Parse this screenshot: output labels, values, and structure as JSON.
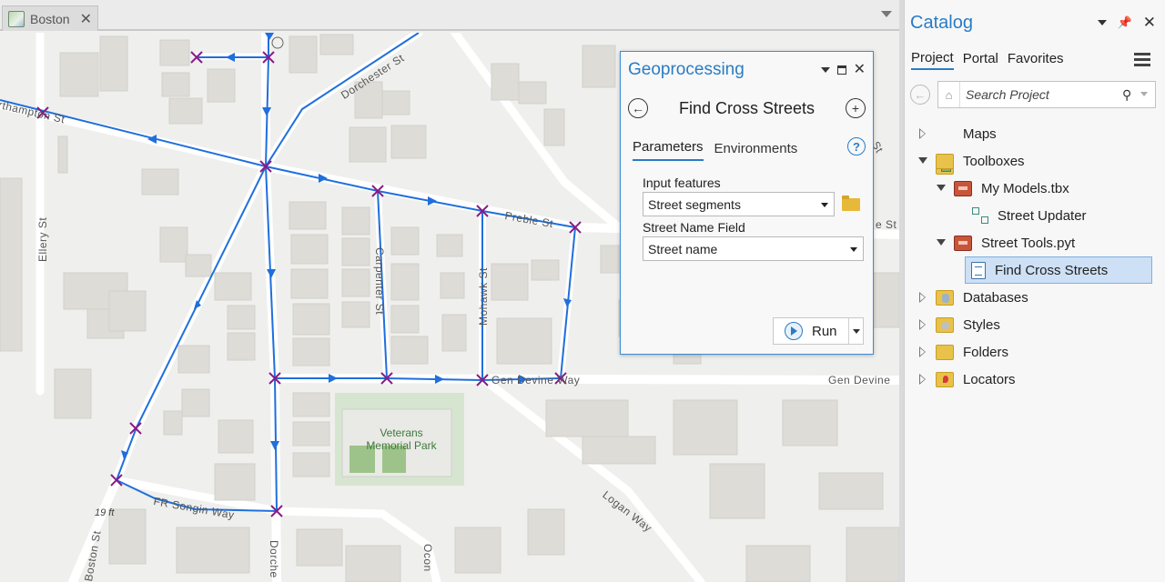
{
  "map_tab": {
    "label": "Boston",
    "close": "✕"
  },
  "map": {
    "street_labels": {
      "northampton": "rthampton St",
      "dorchester_top": "Dorchester St",
      "ellery": "Ellery St",
      "preble": "Preble St",
      "carpenter": "Carpenter St",
      "mohawk": "Mohawk St",
      "gen_devine_1": "Gen Devine Way",
      "gen_devine_2": "Gen Devine",
      "logan": "Logan Way",
      "fr_songin": "FR Songin Way",
      "boston": "Boston St",
      "dorche_bottom": "Dorche",
      "oconn": "Ocon",
      "e_st": "e St",
      "s_st": "s St"
    },
    "park_label": [
      "Veterans",
      "Memorial Park"
    ],
    "elevation": "19 ft",
    "colors": {
      "route": "#1f6fdc",
      "intersection": "#8a1a86",
      "park": "#d6e5cf",
      "building": "#dedcd7"
    }
  },
  "geoprocessing": {
    "title": "Geoprocessing",
    "tool_name": "Find Cross Streets",
    "tabs": [
      "Parameters",
      "Environments"
    ],
    "help": "?",
    "fields": [
      {
        "label": "Input features",
        "value": "Street segments"
      },
      {
        "label": "Street Name Field",
        "value": "Street name"
      }
    ],
    "run_label": "Run"
  },
  "catalog": {
    "title": "Catalog",
    "tabs": [
      "Project",
      "Portal",
      "Favorites"
    ],
    "search_placeholder": "Search Project",
    "tree": [
      {
        "label": "Maps"
      },
      {
        "label": "Toolboxes"
      },
      {
        "label": "My Models.tbx"
      },
      {
        "label": "Street Updater"
      },
      {
        "label": "Street Tools.pyt"
      },
      {
        "label": "Find Cross Streets"
      },
      {
        "label": "Databases"
      },
      {
        "label": "Styles"
      },
      {
        "label": "Folders"
      },
      {
        "label": "Locators"
      }
    ]
  }
}
